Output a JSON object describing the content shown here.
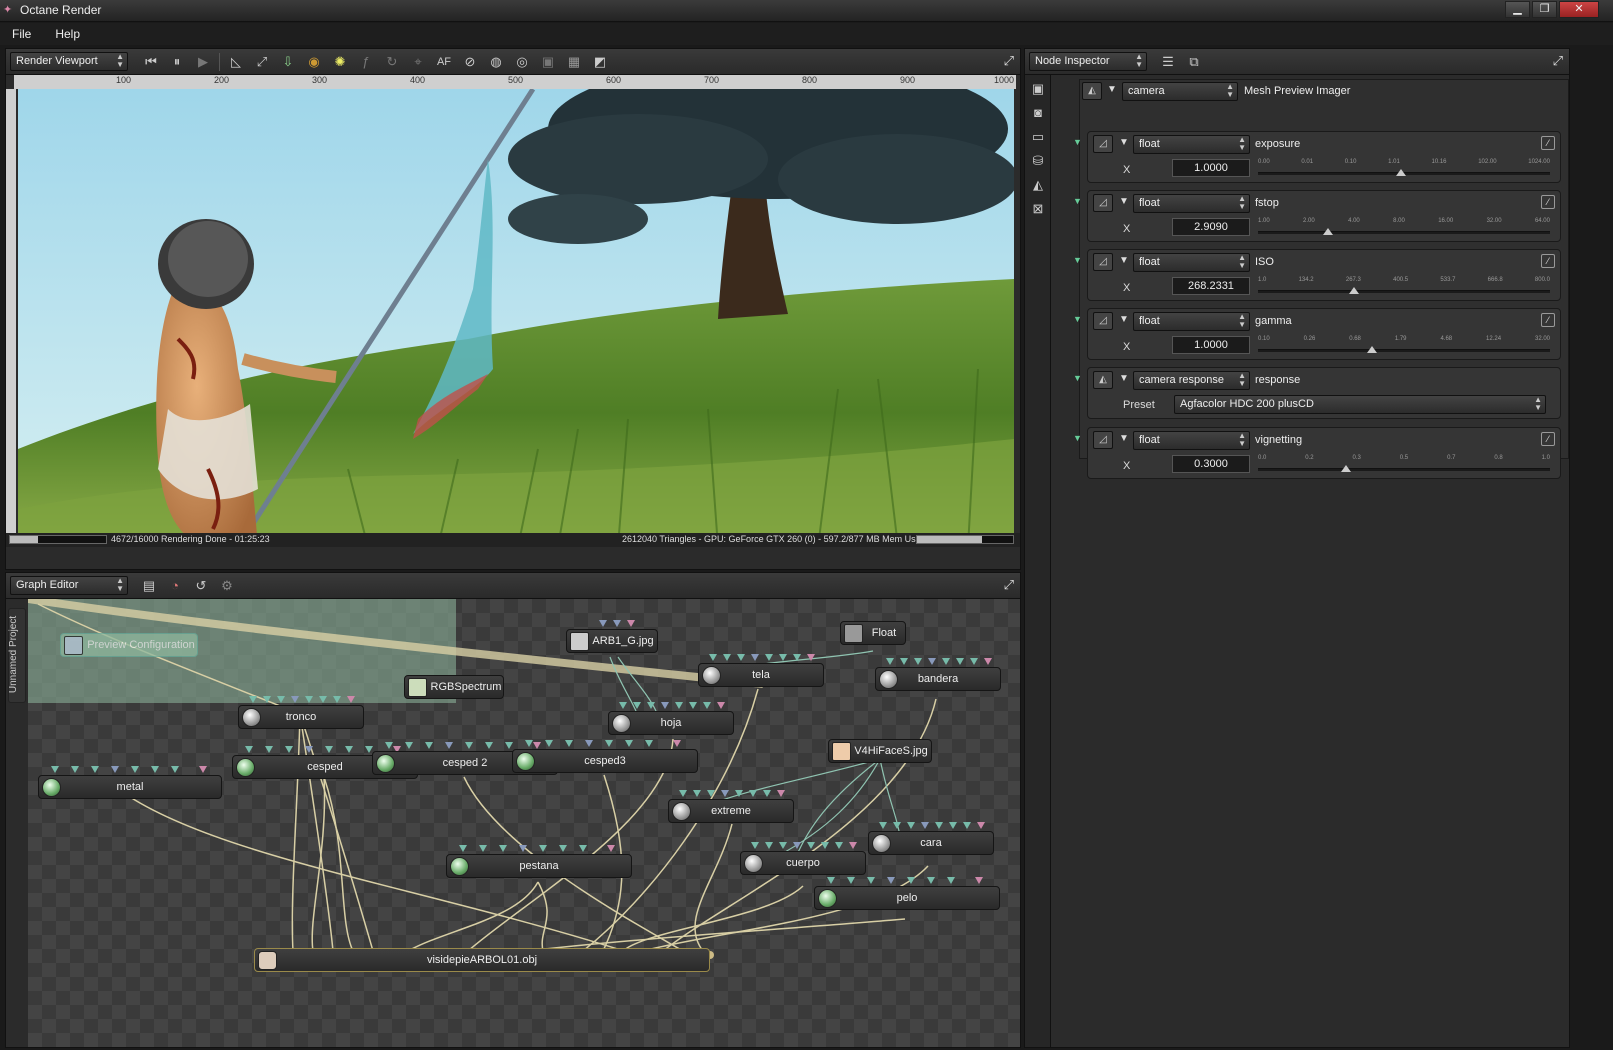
{
  "window": {
    "title": "Octane Render"
  },
  "menu": [
    "File",
    "Help"
  ],
  "viewport": {
    "selector": "Render Viewport",
    "ruler_marks": [
      "100",
      "200",
      "300",
      "400",
      "500",
      "600",
      "700",
      "800",
      "900",
      "1000"
    ],
    "status_left": "4672/16000 Rendering Done - 01:25:23",
    "status_right": "2612040 Triangles - GPU: GeForce GTX 260 (0) - 597.2/877 MB Mem Used",
    "progress": 0.29,
    "mem_progress": 0.68,
    "af_label": "AF"
  },
  "graph": {
    "selector": "Graph Editor",
    "project_tab": "Unnamed Project",
    "nodes": {
      "preview": "Preview Configuration",
      "rgb": "RGBSpectrum",
      "arb1": "ARB1_G.jpg",
      "float": "Float",
      "tela": "tela",
      "bandera": "bandera",
      "tronco": "tronco",
      "hoja": "hoja",
      "v4hi": "V4HiFaceS.jpg",
      "metal": "metal",
      "cesped": "cesped",
      "cesped2": "cesped 2",
      "cesped3": "cesped3",
      "extreme": "extreme",
      "cara": "cara",
      "pestana": "pestana",
      "cuerpo": "cuerpo",
      "pelo": "pelo",
      "mesh": "visidepieARBOL01.obj"
    }
  },
  "inspector": {
    "selector": "Node Inspector",
    "node_type": "camera",
    "node_name": "Mesh Preview Imager",
    "params": [
      {
        "type": "float",
        "name": "exposure",
        "axis": "X",
        "value": "1.0000",
        "ticks": [
          "0.00",
          "0.01",
          "0.10",
          "1.01",
          "10.16",
          "102.00",
          "1024.00"
        ],
        "pos": 0.49
      },
      {
        "type": "float",
        "name": "fstop",
        "axis": "X",
        "value": "2.9090",
        "ticks": [
          "1.00",
          "2.00",
          "4.00",
          "8.00",
          "16.00",
          "32.00",
          "64.00"
        ],
        "pos": 0.24
      },
      {
        "type": "float",
        "name": "ISO",
        "axis": "X",
        "value": "268.2331",
        "ticks": [
          "1.0",
          "134.2",
          "267.3",
          "400.5",
          "533.7",
          "666.8",
          "800.0"
        ],
        "pos": 0.33
      },
      {
        "type": "float",
        "name": "gamma",
        "axis": "X",
        "value": "1.0000",
        "ticks": [
          "0.10",
          "0.26",
          "0.68",
          "1.79",
          "4.68",
          "12.24",
          "32.00"
        ],
        "pos": 0.39
      },
      {
        "type": "float",
        "name": "vignetting",
        "axis": "X",
        "value": "0.3000",
        "ticks": [
          "0.0",
          "0.2",
          "0.3",
          "0.5",
          "0.7",
          "0.8",
          "1.0"
        ],
        "pos": 0.3
      }
    ],
    "response": {
      "type": "camera response",
      "name": "response",
      "preset_label": "Preset",
      "preset": "Agfacolor HDC 200 plusCD"
    }
  },
  "colors": {
    "node_wire": "#d8cfa5",
    "teal_wire": "#8fc4b1",
    "selection": "#8fb89e"
  }
}
